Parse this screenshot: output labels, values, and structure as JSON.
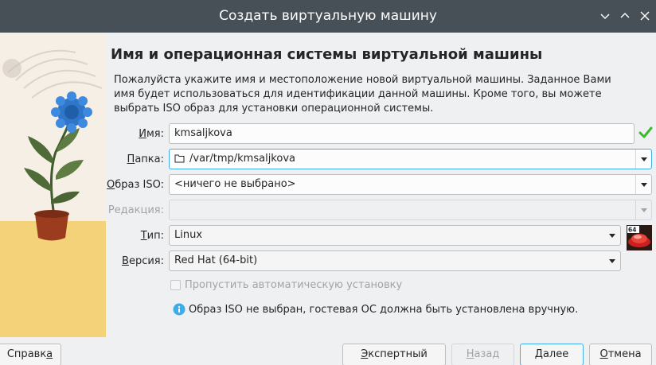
{
  "window": {
    "title": "Создать виртуальную машину",
    "controls": [
      "chevron-down-icon",
      "chevron-up-icon",
      "close-icon"
    ]
  },
  "page": {
    "heading": "Имя и операционная системы виртуальной машины",
    "intro": "Пожалуйста укажите имя и местоположение новой виртуальной машины. Заданное Вами имя будет использоваться для идентификации данной машины. Кроме того, вы можете выбрать ISO образ для установки операционной системы."
  },
  "form": {
    "name": {
      "label": "Имя:",
      "mnemonic": "И",
      "rest": "мя:",
      "value": "kmsaljkova"
    },
    "folder": {
      "label": "Папка:",
      "mnemonic": "П",
      "rest": "апка:",
      "value": "/var/tmp/kmsaljkova"
    },
    "iso": {
      "label": "Образ ISO:",
      "mnemonic": "О",
      "rest": "браз ISO:",
      "value": "<ничего не выбрано>"
    },
    "edition": {
      "label": "Редакция:",
      "value": ""
    },
    "type": {
      "label": "Тип:",
      "mnemonic": "Т",
      "rest": "ип:",
      "value": "Linux",
      "os_badge": "64"
    },
    "version": {
      "label": "Версия:",
      "mnemonic": "В",
      "rest": "ерсия:",
      "value": "Red Hat (64-bit)"
    },
    "skip_unattended": {
      "label": "Пропустить автоматическую установку",
      "checked": false,
      "enabled": false
    },
    "info": "Образ ISO не выбран, гостевая ОС должна быть установлена вручную."
  },
  "buttons": {
    "help": {
      "label": "Справка",
      "pre": "Справк",
      "mnemonic": "а",
      "post": ""
    },
    "expert": {
      "label": "Экспертный режим",
      "pre": "",
      "mnemonic": "Э",
      "post": "кспертный режим"
    },
    "back": {
      "label": "Назад",
      "pre": "",
      "mnemonic": "Н",
      "post": "азад"
    },
    "next": {
      "label": "Далее",
      "pre": "",
      "mnemonic": "Д",
      "post": "алее"
    },
    "cancel": {
      "label": "Отмена",
      "pre": "",
      "mnemonic": "О",
      "post": "тмена"
    }
  },
  "colors": {
    "titlebar": "#475057",
    "accent": "#3daee9",
    "valid": "#3bba2b"
  }
}
